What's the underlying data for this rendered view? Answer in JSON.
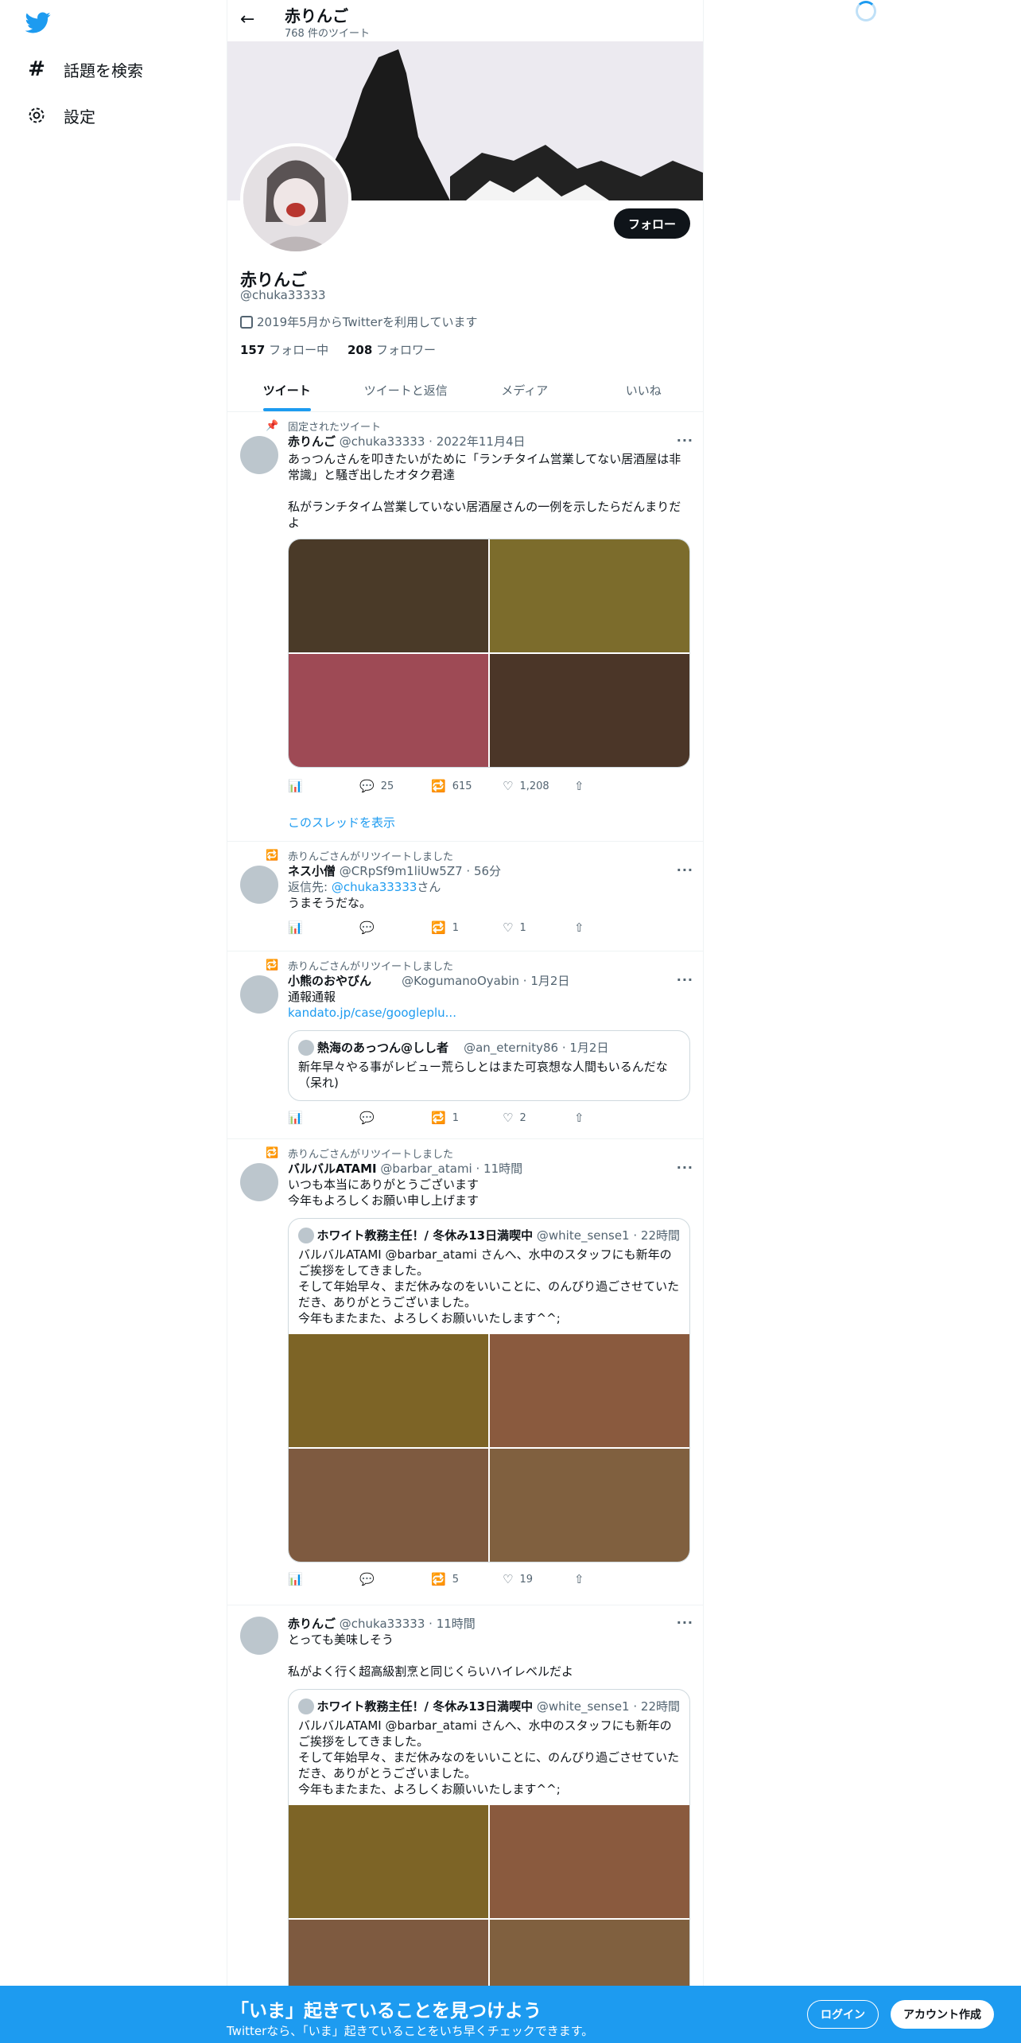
{
  "nav": {
    "items": [
      {
        "label": "話題を検索",
        "icon": "hashtag-icon"
      },
      {
        "label": "設定",
        "icon": "gear-icon"
      }
    ]
  },
  "header": {
    "title": "赤りんご",
    "count": "768 件のツイート"
  },
  "profile": {
    "name": "赤りんご",
    "handle": "@chuka33333",
    "joined": "2019年5月からTwitterを利用しています",
    "following_count": "157",
    "following_label": "フォロー中",
    "followers_count": "208",
    "followers_label": "フォロワー",
    "follow_button": "フォロー"
  },
  "tabs": [
    "ツイート",
    "ツイートと返信",
    "メディア",
    "いいね"
  ],
  "tweets": [
    {
      "context": "固定されたツイート",
      "name": "赤りんご",
      "meta": "@chuka33333 · 2022年11月4日",
      "text1": "あっつんさんを叩きたいがために「ランチタイム営業してない居酒屋は非常識」と騒ぎ出したオタク君達",
      "text2": "私がランチタイム営業していない居酒屋さんの一例を示したらだんまりだよ",
      "images": [
        "#4a3a28",
        "#7c6c2c",
        "#9e4a55",
        "#4b3628"
      ],
      "reply": "25",
      "retweet": "615",
      "like": "1,208",
      "thread": "このスレッドを表示"
    },
    {
      "context": "赤りんごさんがリツイートしました",
      "name": "ネス小僧",
      "meta": "@CRpSf9m1liUw5Z7 · 56分",
      "reply_to_prefix": "返信先: ",
      "reply_to_handle": "@chuka33333",
      "reply_to_suffix": "さん",
      "text": "うまそうだな。",
      "reply": "",
      "retweet": "1",
      "like": "1"
    },
    {
      "context": "赤りんごさんがリツイートしました",
      "name": "小熊のおやびん",
      "meta": "@KogumanoOyabin · 1月2日",
      "text": "通報通報",
      "link": "kandato.jp/case/googleplu...",
      "quote": {
        "name": "熱海のあっつん@しし者",
        "meta": "@an_eternity86 · 1月2日",
        "text": "新年早々やる事がレビュー荒らしとはまた可哀想な人間もいるんだな（呆れ)"
      },
      "reply": "",
      "retweet": "1",
      "like": "2"
    },
    {
      "context": "赤りんごさんがリツイートしました",
      "name": "バルバルATAMI",
      "meta": "@barbar_atami · 11時間",
      "text1": "いつも本当にありがとうございます",
      "text2": "今年もよろしくお願い申し上げます",
      "quote": {
        "name": "ホワイト教務主任！/ 冬休み13日満喫中",
        "meta": "@white_sense1 · 22時間",
        "lines": [
          "バルバルATAMI @barbar_atami さんへ、水中のスタッフにも新年のご挨拶をしてきました。",
          "そして年始早々、まだ休みなのをいいことに、のんびり過ごさせていただき、ありがとうございました。",
          "今年もまたまた、よろしくお願いいたします^^;"
        ],
        "images": [
          "#7d6426",
          "#8a5a3e",
          "#7e5a40",
          "#80603f"
        ]
      },
      "reply": "",
      "retweet": "5",
      "like": "19"
    },
    {
      "context": "",
      "name": "赤りんご",
      "meta": "@chuka33333 · 11時間",
      "text1": "とっても美味しそう",
      "text2": "私がよく行く超高級割烹と同じくらいハイレベルだよ",
      "quote": {
        "name": "ホワイト教務主任！/ 冬休み13日満喫中",
        "meta": "@white_sense1 · 22時間",
        "lines": [
          "バルバルATAMI @barbar_atami さんへ、水中のスタッフにも新年のご挨拶をしてきました。",
          "そして年始早々、まだ休みなのをいいことに、のんびり過ごさせていただき、ありがとうございました。",
          "今年もまたまた、よろしくお願いいたします^^;"
        ],
        "images": [
          "#7d6426",
          "#8a5a3e",
          "#7e5a40",
          "#80603f"
        ]
      }
    }
  ],
  "bottom": {
    "title": "「いま」起きていることを見つけよう",
    "subtitle": "Twitterなら、「いま」起きていることをいち早くチェックできます。",
    "login": "ログイン",
    "signup": "アカウント作成"
  },
  "colors": {
    "accent": "#1d9bf0",
    "text": "#0f1419",
    "secondary": "#536471"
  }
}
